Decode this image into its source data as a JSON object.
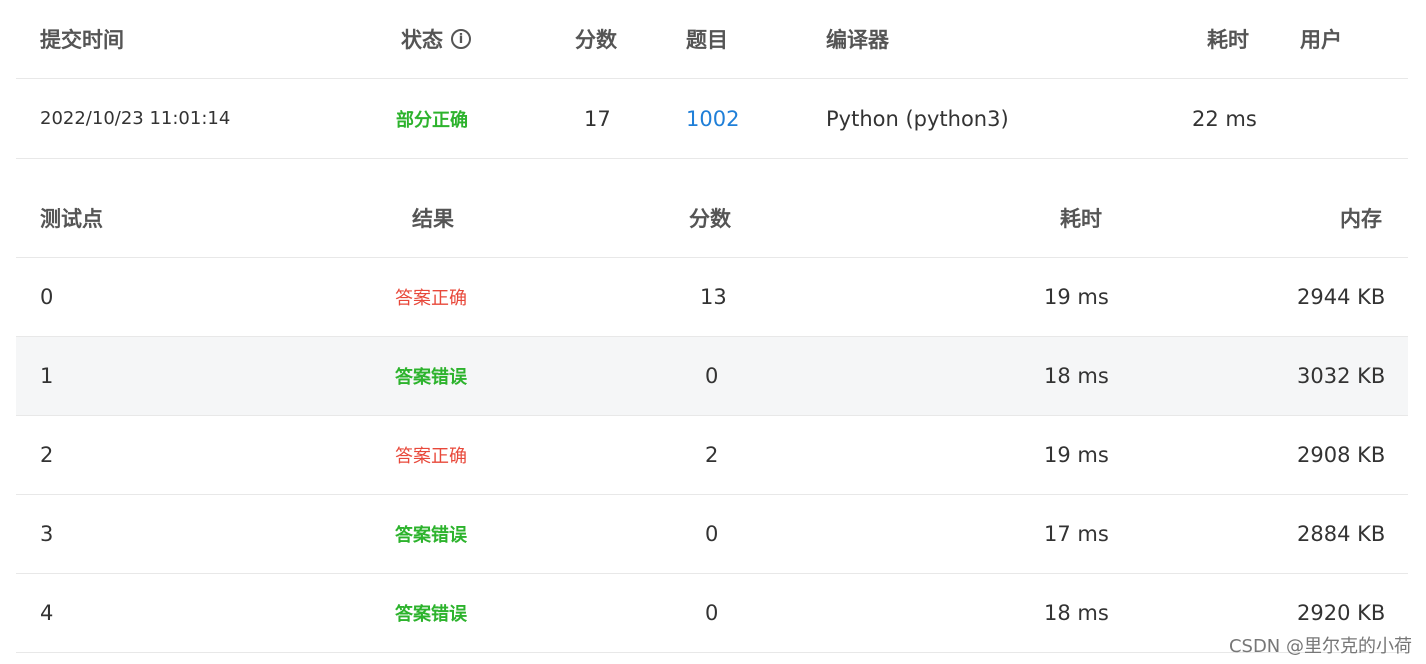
{
  "submission_table": {
    "headers": {
      "time": "提交时间",
      "status": "状态",
      "score": "分数",
      "problem": "题目",
      "compiler": "编译器",
      "elapsed": "耗时",
      "user": "用户"
    },
    "row": {
      "time": "2022/10/23 11:01:14",
      "status": "部分正确",
      "score": "17",
      "problem": "1002",
      "compiler": "Python (python3)",
      "elapsed": "22 ms",
      "user": ""
    }
  },
  "testcase_table": {
    "headers": {
      "case": "测试点",
      "result": "结果",
      "score": "分数",
      "elapsed": "耗时",
      "memory": "内存"
    },
    "rows": [
      {
        "case": "0",
        "result": "答案正确",
        "score": "13",
        "elapsed": "19 ms",
        "memory": "2944 KB"
      },
      {
        "case": "1",
        "result": "答案错误",
        "score": "0",
        "elapsed": "18 ms",
        "memory": "3032 KB"
      },
      {
        "case": "2",
        "result": "答案正确",
        "score": "2",
        "elapsed": "19 ms",
        "memory": "2908 KB"
      },
      {
        "case": "3",
        "result": "答案错误",
        "score": "0",
        "elapsed": "17 ms",
        "memory": "2884 KB"
      },
      {
        "case": "4",
        "result": "答案错误",
        "score": "0",
        "elapsed": "18 ms",
        "memory": "2920 KB"
      }
    ]
  },
  "colors": {
    "accepted": "#e8483a",
    "wrong_answer": "#2db32d",
    "partial": "#2db32d",
    "link": "#1f7fd8",
    "row_alt_bg": "#f5f6f7"
  },
  "icons": {
    "status_info": "info-circle-icon"
  },
  "watermark": "CSDN @里尔克的小荷"
}
